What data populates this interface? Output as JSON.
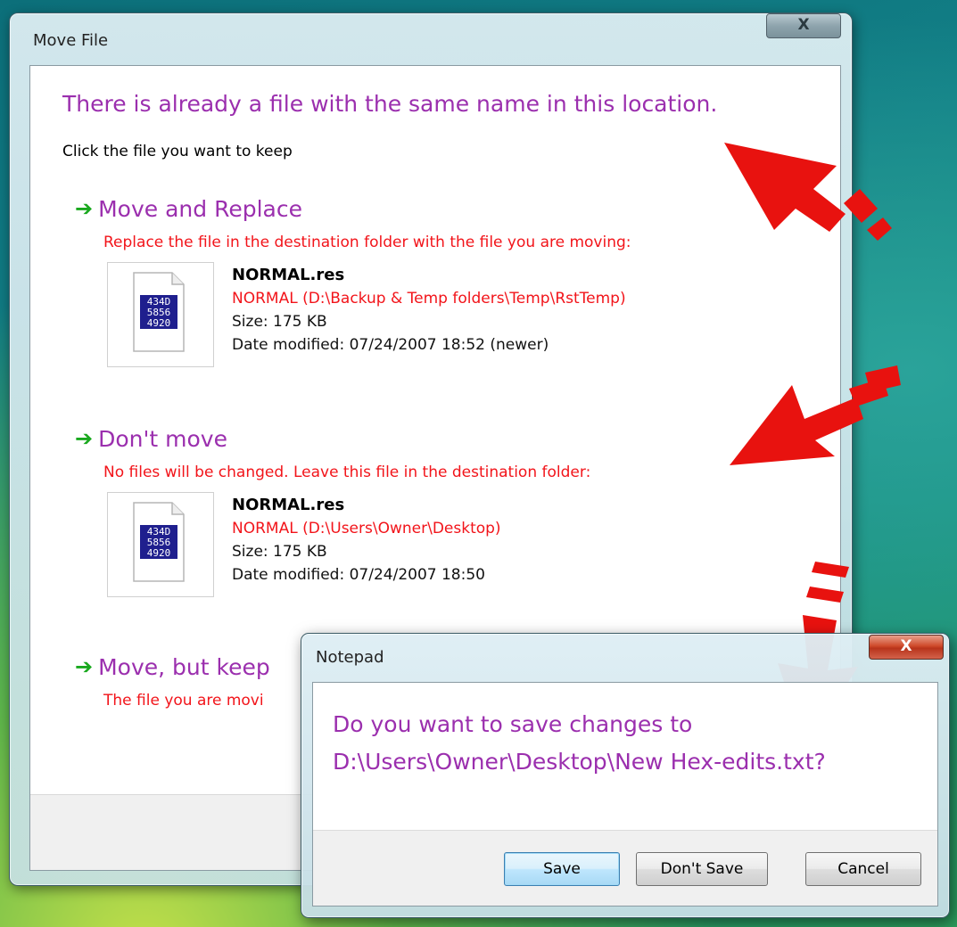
{
  "move_dialog": {
    "title": "Move File",
    "close_label": "X",
    "headline": "There is already a file with the same name in this location.",
    "subline": "Click the file you want to keep",
    "options": [
      {
        "title": "Move and Replace",
        "description": "Replace the file in the destination folder with the file you are moving:",
        "file": {
          "name": "NORMAL.res",
          "path": "NORMAL (D:\\Backup & Temp folders\\Temp\\RstTemp)",
          "size": "Size: 175 KB",
          "date": "Date modified: 07/24/2007 18:52 (newer)"
        }
      },
      {
        "title": "Don't move",
        "description": "No files will be changed. Leave this file in the destination folder:",
        "file": {
          "name": "NORMAL.res",
          "path": "NORMAL (D:\\Users\\Owner\\Desktop)",
          "size": "Size: 175 KB",
          "date": "Date modified: 07/24/2007 18:50"
        }
      },
      {
        "title": "Move, but keep",
        "description": "The file you are movi"
      }
    ],
    "file_icon_text": [
      "434D",
      "5856",
      "4920"
    ]
  },
  "notepad_dialog": {
    "title": "Notepad",
    "close_label": "X",
    "message_line1": "Do you want to save changes to",
    "message_line2": "D:\\Users\\Owner\\Desktop\\New Hex-edits.txt?",
    "buttons": {
      "save": "Save",
      "dont_save": "Don't Save",
      "cancel": "Cancel"
    }
  },
  "colors": {
    "headline": "#9b2fae",
    "description": "#f2141a",
    "arrow_green": "#18a81d",
    "annotation_red": "#e8120f"
  }
}
